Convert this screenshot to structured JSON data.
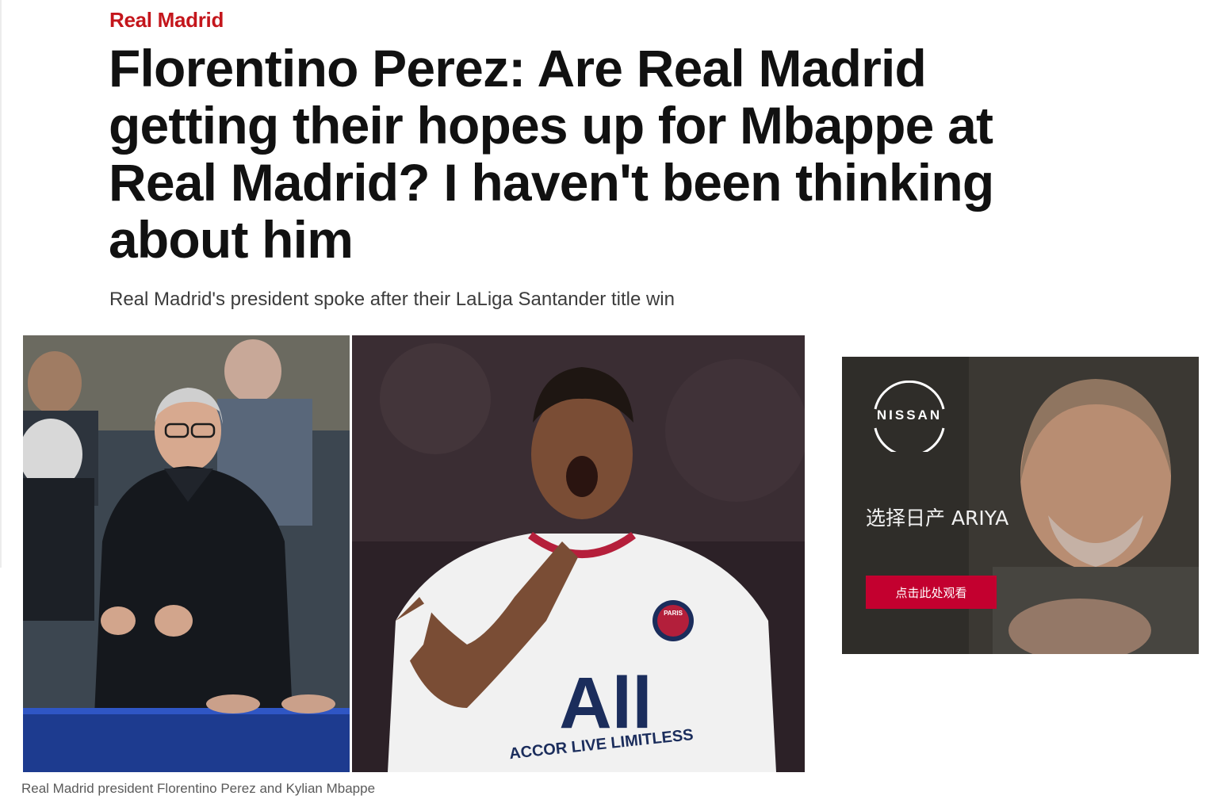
{
  "article": {
    "section": "Real Madrid",
    "headline": "Florentino Perez: Are Real Madrid getting their hopes up for Mbappe at Real Madrid? I haven't been thinking about him",
    "subheadline": "Real Madrid's president spoke after their LaLiga Santander title win",
    "image": {
      "caption": "Real Madrid president Florentino Perez and Kylian Mbappe",
      "jersey_sponsor": "ACCOR LIVE LIMITLESS",
      "jersey_wordmark": "All",
      "badge_text": "PARIS"
    }
  },
  "ad": {
    "brand": "NISSAN",
    "tagline": "选择日产 ARIYA",
    "cta_label": "点击此处观看"
  },
  "colors": {
    "section_red": "#c4161c",
    "headline": "#111111",
    "cta": "#c3002f"
  }
}
